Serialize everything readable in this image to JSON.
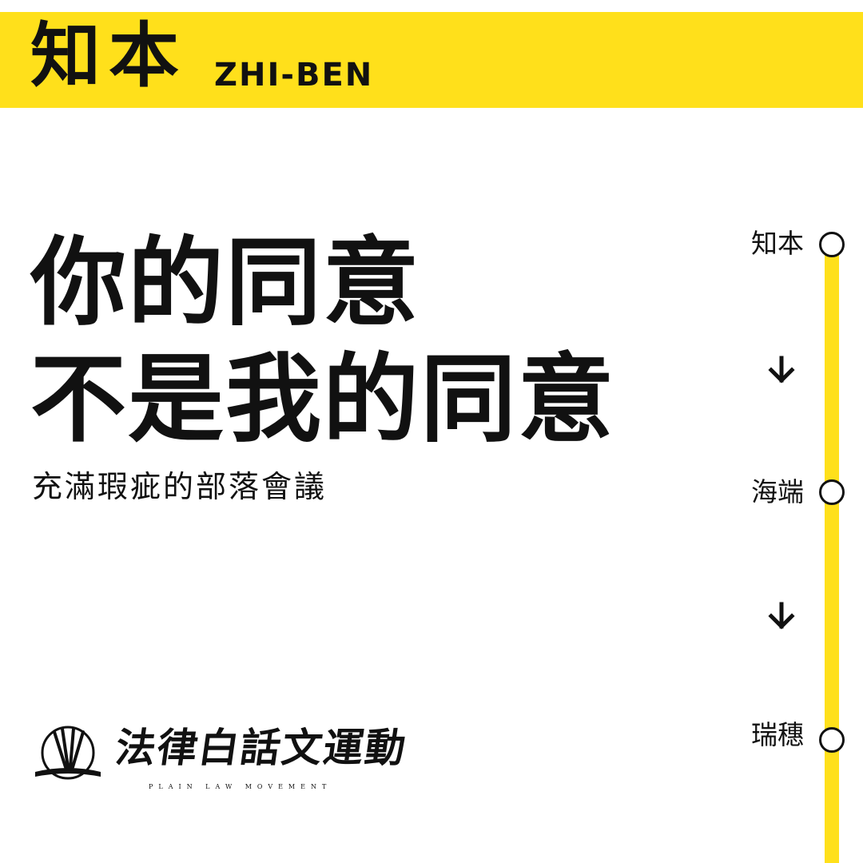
{
  "header": {
    "brand_cn": "知本",
    "brand_en": "ZHI-BEN"
  },
  "main": {
    "headline_line1": "你的同意",
    "headline_line2": "不是我的同意",
    "subtitle": "充滿瑕疵的部落會議"
  },
  "route": {
    "stations": [
      {
        "label": "知本"
      },
      {
        "label": "海端"
      },
      {
        "label": "瑞穗"
      }
    ]
  },
  "logo": {
    "name_cn": "法律白話文運動",
    "name_en": "PLAIN LAW MOVEMENT"
  },
  "colors": {
    "accent": "#FFE01B",
    "text": "#111111"
  },
  "icons": [
    "arrow-down-icon",
    "station-circle-icon",
    "logo-emblem-icon"
  ]
}
